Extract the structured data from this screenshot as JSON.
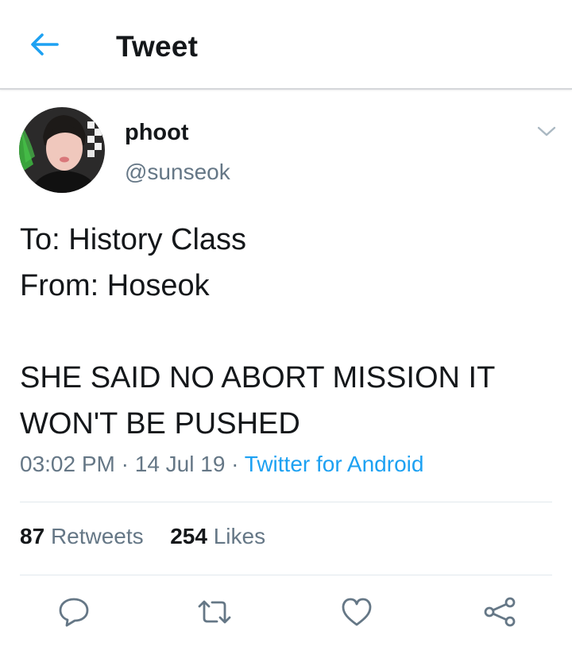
{
  "header": {
    "title": "Tweet"
  },
  "author": {
    "display_name": "phoot",
    "handle": "@sunseok"
  },
  "tweet": {
    "lines": [
      "To: History Class",
      "From: Hoseok",
      "",
      "SHE SAID NO ABORT MISSION IT",
      "WON'T BE PUSHED"
    ]
  },
  "meta": {
    "time": "03:02 PM",
    "date": "14 Jul 19",
    "source": "Twitter for Android",
    "separator": "·"
  },
  "stats": {
    "retweets_count": "87",
    "retweets_label": "Retweets",
    "likes_count": "254",
    "likes_label": "Likes"
  },
  "icons": {
    "back": "arrow-left-icon",
    "menu": "chevron-down-icon",
    "reply": "reply-icon",
    "retweet": "retweet-icon",
    "like": "heart-icon",
    "share": "share-icon"
  },
  "colors": {
    "accent": "#1da1f2",
    "secondary_text": "#657786",
    "primary_text": "#14171a"
  }
}
